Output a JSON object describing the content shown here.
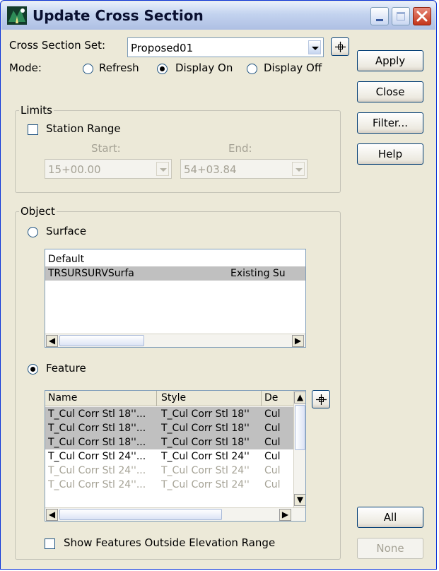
{
  "window": {
    "title": "Update Cross Section",
    "icon": "bentley-road-icon"
  },
  "controls": {
    "minimize_icon": "minimize-icon",
    "maximize_icon": "maximize-icon",
    "close_icon": "close-icon"
  },
  "cross_section_set": {
    "label": "Cross Section Set:",
    "value": "Proposed01",
    "locate_icon": "crosshair-icon"
  },
  "mode": {
    "label": "Mode:",
    "options": [
      "Refresh",
      "Display On",
      "Display Off"
    ],
    "selected": "Display On"
  },
  "limits": {
    "title": "Limits",
    "station_range_label": "Station Range",
    "station_range_checked": false,
    "start_label": "Start:",
    "end_label": "End:",
    "start_value": "15+00.00",
    "end_value": "54+03.84"
  },
  "object": {
    "title": "Object",
    "surface_label": "Surface",
    "surface_selected": false,
    "surfaces": [
      {
        "name": "Default",
        "description": ""
      },
      {
        "name": "TRSURSURVSurfa",
        "description": "Existing Su"
      }
    ],
    "feature_label": "Feature",
    "feature_selected": true,
    "feature_columns": [
      "Name",
      "Style",
      "De"
    ],
    "features": [
      {
        "name": "T_Cul Corr Stl 18''...",
        "style": "T_Cul Corr Stl 18''",
        "desc": "Cul"
      },
      {
        "name": "T_Cul Corr Stl 18''...",
        "style": "T_Cul Corr Stl 18''",
        "desc": "Cul"
      },
      {
        "name": "T_Cul Corr Stl 18''...",
        "style": "T_Cul Corr Stl 18''",
        "desc": "Cul"
      },
      {
        "name": "T_Cul Corr Stl 24''...",
        "style": "T_Cul Corr Stl 24''",
        "desc": "Cul"
      },
      {
        "name": "T_Cul Corr Stl 24''...",
        "style": "T_Cul Corr Stl 24''",
        "desc": "Cul"
      },
      {
        "name": "T_Cul Corr Stl 24''...",
        "style": "T_Cul Corr Stl 24''",
        "desc": "Cul"
      }
    ],
    "show_outside_label": "Show Features Outside Elevation Range",
    "show_outside_checked": false
  },
  "buttons": {
    "apply": "Apply",
    "close": "Close",
    "filter": "Filter...",
    "help": "Help",
    "all": "All",
    "none": "None"
  }
}
